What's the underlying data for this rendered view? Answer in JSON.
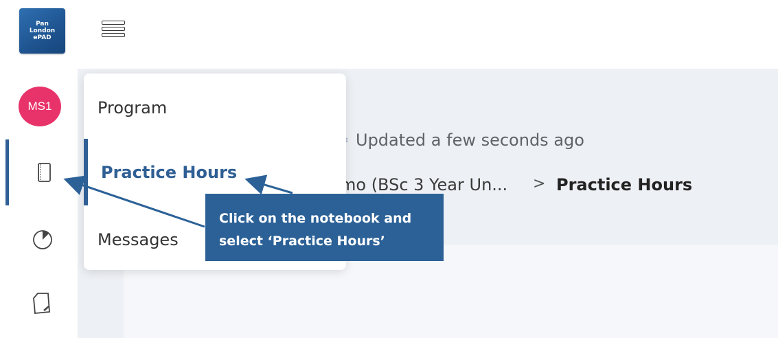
{
  "logo": {
    "lines": [
      "Pan",
      "London",
      "ePAD"
    ]
  },
  "sidebar": {
    "avatar_initials": "MS1"
  },
  "header": {
    "updated_text": "Updated a few seconds ago"
  },
  "breadcrumb": {
    "parent": "mo (BSc 3 Year Un...",
    "separator": ">",
    "current": "Practice Hours"
  },
  "menu": {
    "items": [
      {
        "label": "Program"
      },
      {
        "label": "Practice Hours",
        "active": true
      },
      {
        "label": "Messages"
      }
    ]
  },
  "callout": {
    "line1": "Click on the notebook and",
    "line2": "select ‘Practice Hours’"
  },
  "colors": {
    "brand_blue": "#2c6197",
    "avatar": "#e8336a",
    "active": "#2f5f94"
  }
}
